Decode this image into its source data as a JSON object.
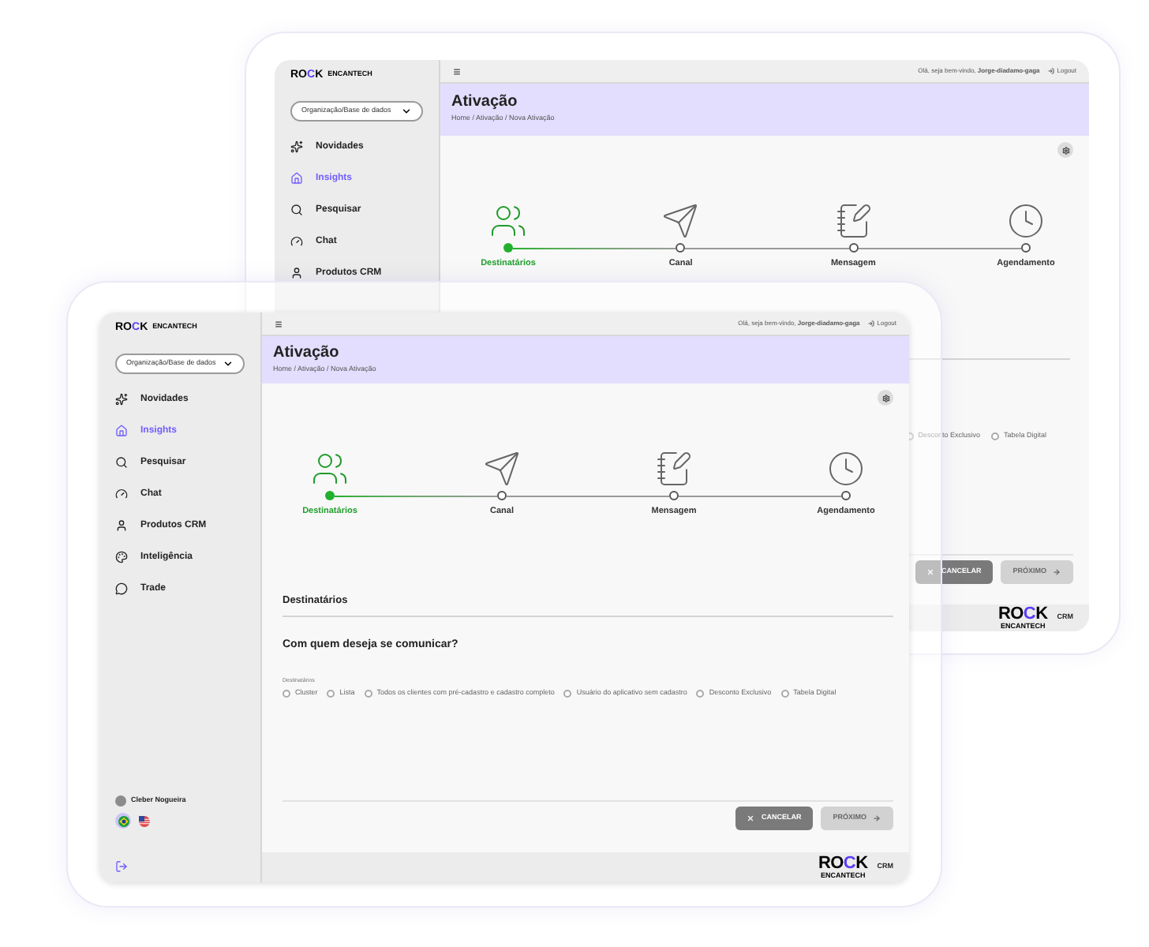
{
  "back_window": {
    "sidebar": {
      "logo": {
        "letters": [
          {
            "text": "RO",
            "accent": false
          },
          {
            "text": "C",
            "accent": true
          },
          {
            "text": "K",
            "accent": false
          }
        ],
        "tagline": "ENCANTECH"
      },
      "org_select": {
        "value": "Organização/Base de dados"
      },
      "items": [
        {
          "label": "Novidades",
          "selected": false
        },
        {
          "label": "Insights",
          "selected": true
        },
        {
          "label": "Pesquisar",
          "selected": false
        },
        {
          "label": "Chat",
          "selected": false
        },
        {
          "label": "Produtos CRM",
          "selected": false
        }
      ]
    },
    "top_bar": {
      "greeting": "Olá, seja bem-vindo, **Jorge-diadamo-gaga**",
      "logout": "Logout"
    },
    "header": {
      "title": "Ativação",
      "breadcrumb": "Home / Ativação / Nova Ativação"
    },
    "steps": [
      {
        "label": "Destinatários",
        "selected": true
      },
      {
        "label": "Canal",
        "selected": false
      },
      {
        "label": "Mensagem",
        "selected": false
      },
      {
        "label": "Agendamento",
        "selected": false
      }
    ],
    "options": [
      {
        "label": "Desconto Exclusivo",
        "selected": false
      },
      {
        "label": "Tabela Digital",
        "selected": false
      }
    ],
    "buttons": {
      "cancel": "CANCELAR",
      "next": "PRÓXIMO"
    },
    "footer": {
      "logo": {
        "letters": [
          {
            "text": "RO",
            "accent": false
          },
          {
            "text": "C",
            "accent": true
          },
          {
            "text": "K",
            "accent": false
          }
        ],
        "tagline": "ENCANTECH"
      },
      "product": "CRM"
    }
  },
  "front_window": {
    "sidebar": {
      "logo": {
        "letters": [
          {
            "text": "RO",
            "accent": false
          },
          {
            "text": "C",
            "accent": true
          },
          {
            "text": "K",
            "accent": false
          }
        ],
        "tagline": "ENCANTECH"
      },
      "org_select": {
        "value": "Organização/Base de dados"
      },
      "items": [
        {
          "label": "Novidades",
          "selected": false
        },
        {
          "label": "Insights",
          "selected": true
        },
        {
          "label": "Pesquisar",
          "selected": false
        },
        {
          "label": "Chat",
          "selected": false
        },
        {
          "label": "Produtos CRM",
          "selected": false
        },
        {
          "label": "Inteligência",
          "selected": false
        },
        {
          "label": "Trade",
          "selected": false
        }
      ],
      "user": {
        "name": "Cleber Nogueira"
      },
      "languages": [
        {
          "kind": "br",
          "selected": true
        },
        {
          "kind": "us",
          "selected": false
        }
      ]
    },
    "top_bar": {
      "greeting": "Olá, seja bem-vindo, **Jorge-diadamo-gaga**",
      "logout": "Logout"
    },
    "header": {
      "title": "Ativação",
      "breadcrumb": "Home / Ativação / Nova Ativação"
    },
    "steps": [
      {
        "label": "Destinatários",
        "selected": true
      },
      {
        "label": "Canal",
        "selected": false
      },
      {
        "label": "Mensagem",
        "selected": false
      },
      {
        "label": "Agendamento",
        "selected": false
      }
    ],
    "section_title": "Destinatários",
    "question": "Com quem deseja se comunicar?",
    "options_label": "Destinatários",
    "options": [
      {
        "label": "Cluster",
        "selected": false
      },
      {
        "label": "Lista",
        "selected": false
      },
      {
        "label": "Todos os clientes com pré-cadastro e cadastro completo",
        "selected": false
      },
      {
        "label": "Usuário do aplicativo sem cadastro",
        "selected": false
      },
      {
        "label": "Desconto Exclusivo",
        "selected": false
      },
      {
        "label": "Tabela Digital",
        "selected": false
      }
    ],
    "buttons": {
      "cancel": "CANCELAR",
      "next": "PRÓXIMO"
    },
    "footer": {
      "logo": {
        "letters": [
          {
            "text": "RO",
            "accent": false
          },
          {
            "text": "C",
            "accent": true
          },
          {
            "text": "K",
            "accent": false
          }
        ],
        "tagline": "ENCANTECH"
      },
      "product": "CRM"
    }
  }
}
